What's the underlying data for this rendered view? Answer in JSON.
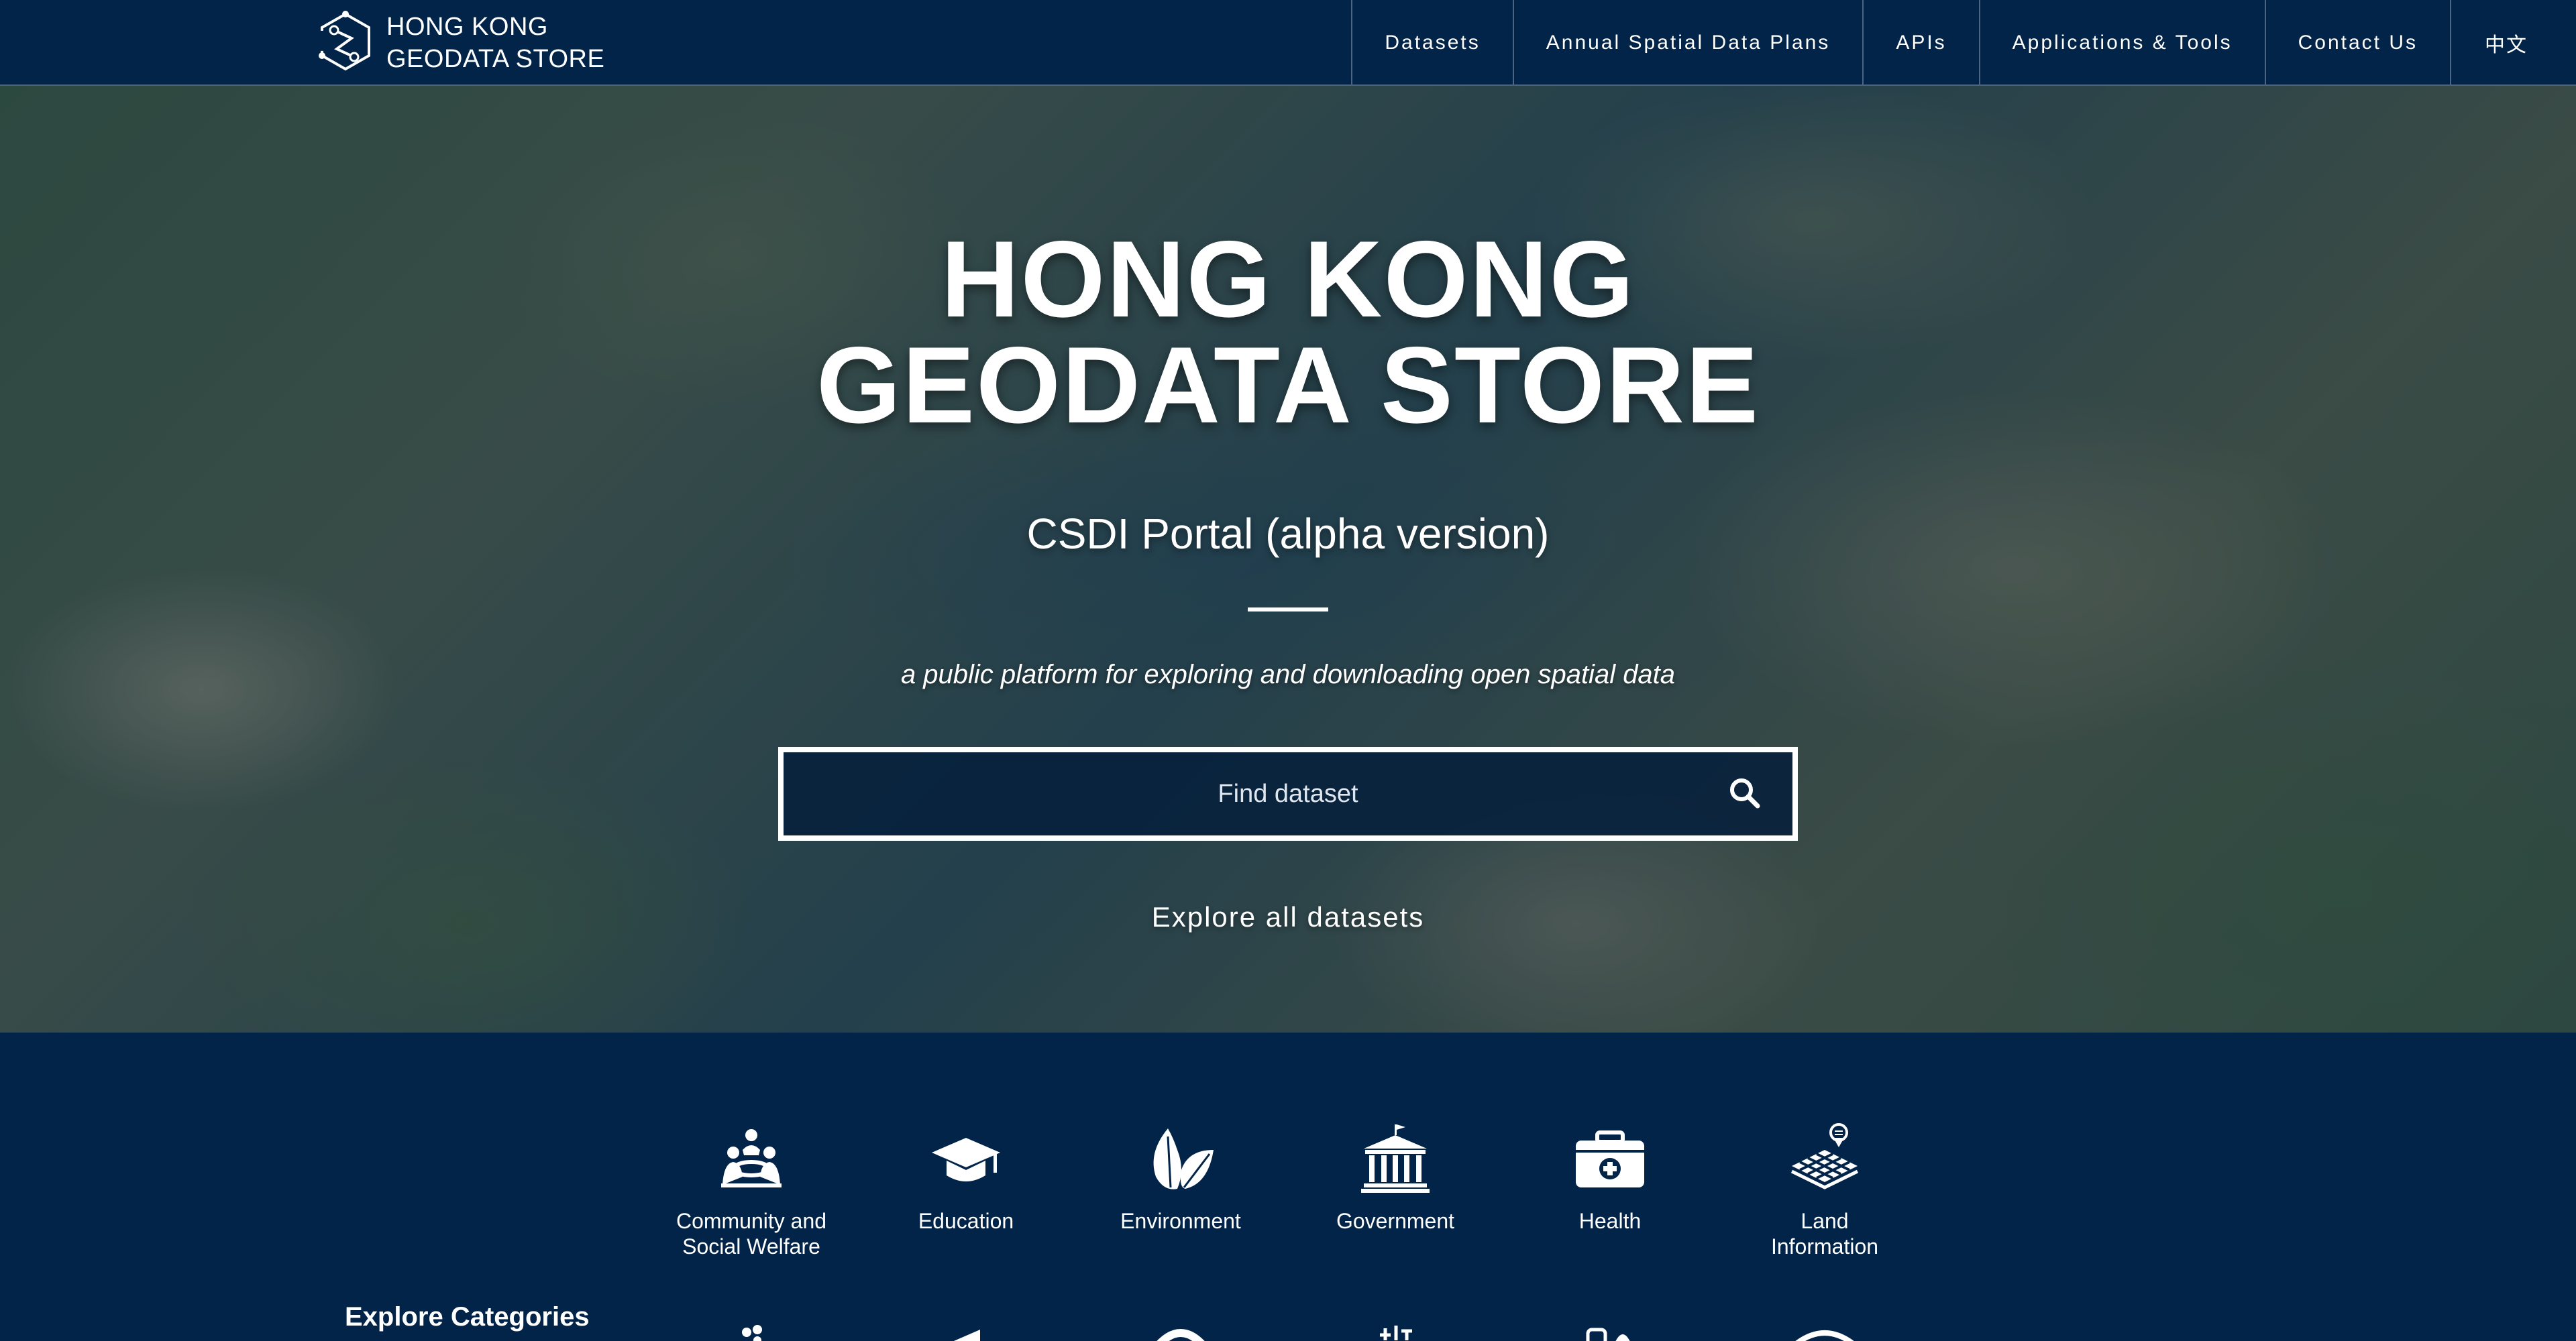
{
  "nav": {
    "brand_line1": "HONG KONG",
    "brand_line2": "GEODATA STORE",
    "links": [
      {
        "label": "Datasets"
      },
      {
        "label": "Annual Spatial Data Plans"
      },
      {
        "label": "APIs"
      },
      {
        "label": "Applications & Tools"
      },
      {
        "label": "Contact Us"
      },
      {
        "label": "中文"
      }
    ]
  },
  "hero": {
    "title_line1": "HONG KONG",
    "title_line2": "GEODATA STORE",
    "subtitle": "CSDI Portal (alpha version)",
    "tagline": "a public platform for exploring and downloading open spatial data",
    "search_placeholder": "Find dataset",
    "explore_link": "Explore all datasets"
  },
  "categories": {
    "heading": "Explore Categories",
    "items": [
      {
        "label": "Community and Social Welfare",
        "icon": "community-icon"
      },
      {
        "label": "Education",
        "icon": "graduation-cap-icon"
      },
      {
        "label": "Environment",
        "icon": "leaf-icon"
      },
      {
        "label": "Government",
        "icon": "government-building-icon"
      },
      {
        "label": "Health",
        "icon": "medical-kit-icon"
      },
      {
        "label": "Land Information",
        "icon": "land-grid-icon"
      }
    ]
  },
  "colors": {
    "navy": "#022448",
    "nav_border": "#4a6483",
    "text": "#ffffff"
  }
}
